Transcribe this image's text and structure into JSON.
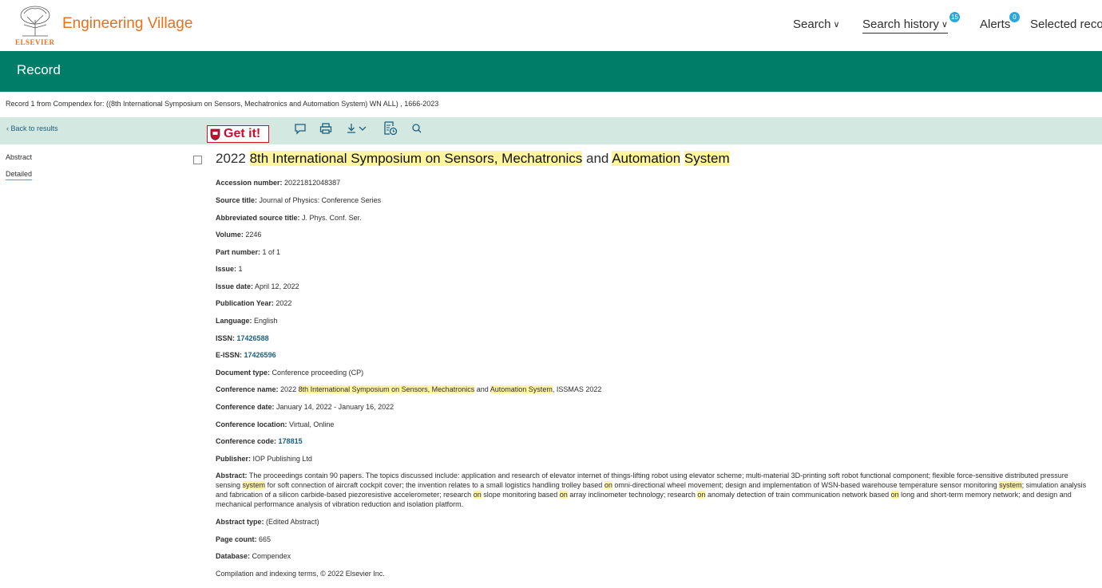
{
  "header": {
    "brand": "Engineering Village",
    "logo_text": "ELSEVIER",
    "nav": {
      "search": "Search",
      "search_history": "Search history",
      "search_history_badge": "15",
      "alerts": "Alerts",
      "alerts_badge": "0",
      "selected_records": "Selected recor"
    }
  },
  "band": {
    "title": "Record"
  },
  "record_line": "Record 1 from Compendex for: ((8th International Symposium on Sensors, Mechatronics and Automation System) WN ALL) , 1666-2023",
  "toolbar": {
    "back": "Back to results",
    "getit": "Get it!",
    "icons": [
      "comment-icon",
      "print-icon",
      "download-icon",
      "citation-icon",
      "search-icon"
    ]
  },
  "sidebar": {
    "abstract": "Abstract",
    "detailed": "Detailed"
  },
  "title": {
    "year": "2022",
    "part1": "8th International Symposium on Sensors, Mechatronics",
    "and": "and",
    "part2": "Automation",
    "part3": "System"
  },
  "fields": {
    "accession_label": "Accession number:",
    "accession_value": "20221812048387",
    "source_label": "Source title:",
    "source_value": "Journal of Physics: Conference Series",
    "abbrev_label": "Abbreviated source title:",
    "abbrev_value": "J. Phys. Conf. Ser.",
    "volume_label": "Volume:",
    "volume_value": "2246",
    "part_label": "Part number:",
    "part_value": "1 of 1",
    "issue_label": "Issue:",
    "issue_value": "1",
    "issue_date_label": "Issue date:",
    "issue_date_value": "April 12, 2022",
    "pub_year_label": "Publication Year:",
    "pub_year_value": "2022",
    "language_label": "Language:",
    "language_value": "English",
    "issn_label": "ISSN:",
    "issn_value": "17426588",
    "eissn_label": "E-ISSN:",
    "eissn_value": "17426596",
    "doctype_label": "Document type:",
    "doctype_value": "Conference proceeding (CP)",
    "conf_name_label": "Conference name:",
    "conf_name_year": "2022",
    "conf_name_hl1": "8th International Symposium on Sensors, Mechatronics",
    "conf_name_and": "and",
    "conf_name_hl2": "Automation System",
    "conf_name_tail": ", ISSMAS 2022",
    "conf_date_label": "Conference date:",
    "conf_date_value": "January 14, 2022 - January 16, 2022",
    "conf_loc_label": "Conference location:",
    "conf_loc_value": "Virtual, Online",
    "conf_code_label": "Conference code:",
    "conf_code_value": "178815",
    "publisher_label": "Publisher:",
    "publisher_value": "IOP Publishing Ltd",
    "abstract_label": "Abstract:",
    "abstract_parts": {
      "a1": "The proceedings contain 90 papers. The topics discussed include: application and research of elevator internet of things-lifting robot using elevator scheme; multi-material 3D-printing soft robot functional component; flexible force-sensitive distributed pressure sensing",
      "h1": "system",
      "a2": "for soft connection of aircraft cockpit cover; the invention relates to a small logistics handling trolley based",
      "h2": "on",
      "a3": "omni-directional wheel movement; design and implementation of WSN-based warehouse temperature sensor monitoring",
      "h3": "system",
      "a4": "; simulation analysis and fabrication of a silicon carbide-based piezoresistive accelerometer; research",
      "h4": "on",
      "a5": "slope monitoring based",
      "h5": "on",
      "a6": "array inclinometer technology; research",
      "h6": "on",
      "a7": "anomaly detection of train communication network based",
      "h7": "on",
      "a8": "long and short-term memory network; and design and mechanical performance analysis of vibration reduction and isolation platform."
    },
    "abstract_type_label": "Abstract type:",
    "abstract_type_value": "(Edited Abstract)",
    "page_count_label": "Page count:",
    "page_count_value": "665",
    "database_label": "Database:",
    "database_value": "Compendex",
    "copyright": "Compilation and indexing terms, © 2022 Elsevier Inc."
  }
}
